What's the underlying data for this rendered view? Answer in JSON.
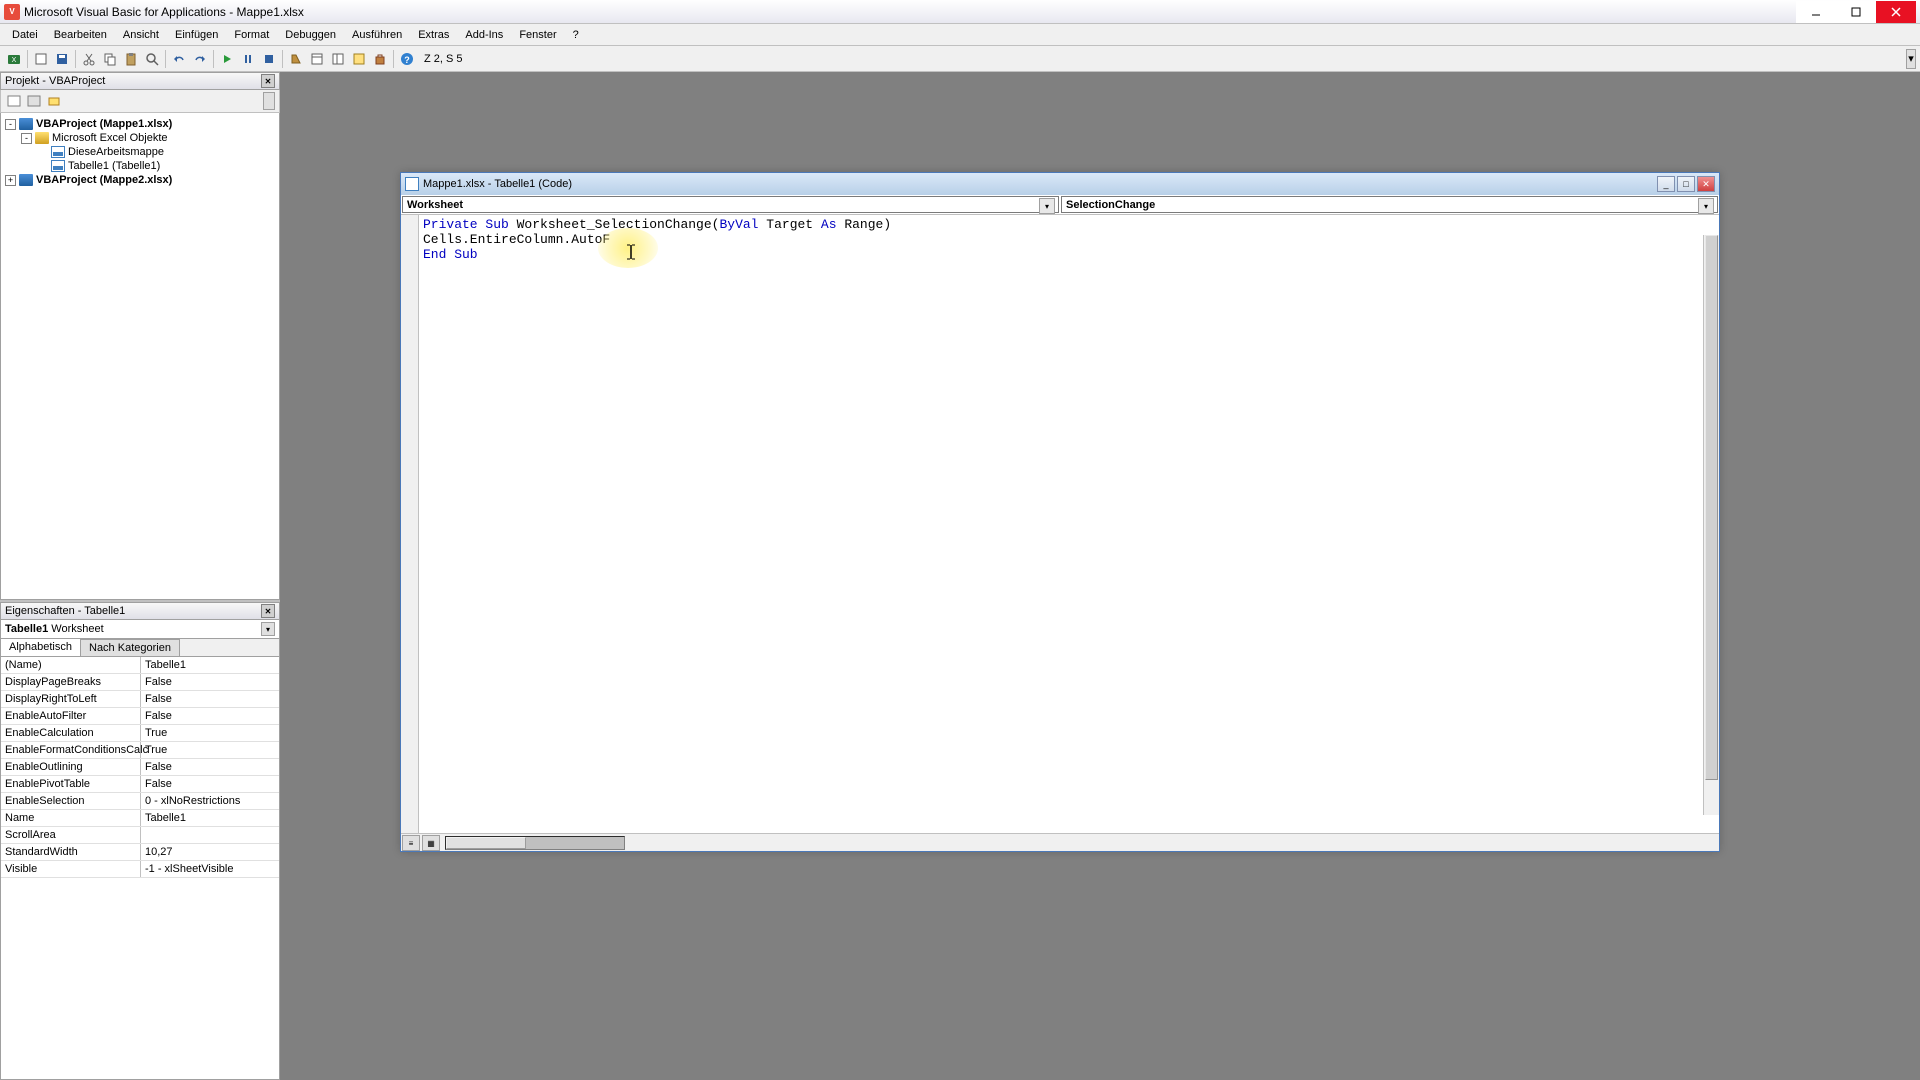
{
  "app": {
    "title": "Microsoft Visual Basic for Applications - Mappe1.xlsx"
  },
  "menubar": [
    "Datei",
    "Bearbeiten",
    "Ansicht",
    "Einfügen",
    "Format",
    "Debuggen",
    "Ausführen",
    "Extras",
    "Add-Ins",
    "Fenster",
    "?"
  ],
  "toolbar_text": "Z 2, S 5",
  "project_panel": {
    "title": "Projekt - VBAProject",
    "items": [
      {
        "expand": "-",
        "indent": 0,
        "icon": "project",
        "label": "VBAProject (Mappe1.xlsx)",
        "bold": true
      },
      {
        "expand": "-",
        "indent": 1,
        "icon": "folder",
        "label": "Microsoft Excel Objekte",
        "bold": false
      },
      {
        "expand": "",
        "indent": 2,
        "icon": "sheet",
        "label": "DieseArbeitsmappe",
        "bold": false
      },
      {
        "expand": "",
        "indent": 2,
        "icon": "sheet",
        "label": "Tabelle1 (Tabelle1)",
        "bold": false
      },
      {
        "expand": "+",
        "indent": 0,
        "icon": "project",
        "label": "VBAProject (Mappe2.xlsx)",
        "bold": true
      }
    ]
  },
  "props_panel": {
    "title": "Eigenschaften - Tabelle1",
    "object_name": "Tabelle1",
    "object_type": "Worksheet",
    "tabs": [
      "Alphabetisch",
      "Nach Kategorien"
    ],
    "rows": [
      {
        "k": "(Name)",
        "v": "Tabelle1"
      },
      {
        "k": "DisplayPageBreaks",
        "v": "False"
      },
      {
        "k": "DisplayRightToLeft",
        "v": "False"
      },
      {
        "k": "EnableAutoFilter",
        "v": "False"
      },
      {
        "k": "EnableCalculation",
        "v": "True"
      },
      {
        "k": "EnableFormatConditionsCalc",
        "v": "True"
      },
      {
        "k": "EnableOutlining",
        "v": "False"
      },
      {
        "k": "EnablePivotTable",
        "v": "False"
      },
      {
        "k": "EnableSelection",
        "v": "0 - xlNoRestrictions"
      },
      {
        "k": "Name",
        "v": "Tabelle1"
      },
      {
        "k": "ScrollArea",
        "v": ""
      },
      {
        "k": "StandardWidth",
        "v": "10,27"
      },
      {
        "k": "Visible",
        "v": "-1 - xlSheetVisible"
      }
    ]
  },
  "code_window": {
    "title": "Mappe1.xlsx - Tabelle1 (Code)",
    "dropdown_left": "Worksheet",
    "dropdown_right": "SelectionChange",
    "code": {
      "k1": "Private Sub",
      "t1": " Worksheet_SelectionChange(",
      "k1b": "ByVal",
      "t1b": " Target ",
      "k1c": "As",
      "t1c": " Range)",
      "l2": "Cells.EntireColumn.AutoF",
      "k3": "End Sub"
    }
  }
}
